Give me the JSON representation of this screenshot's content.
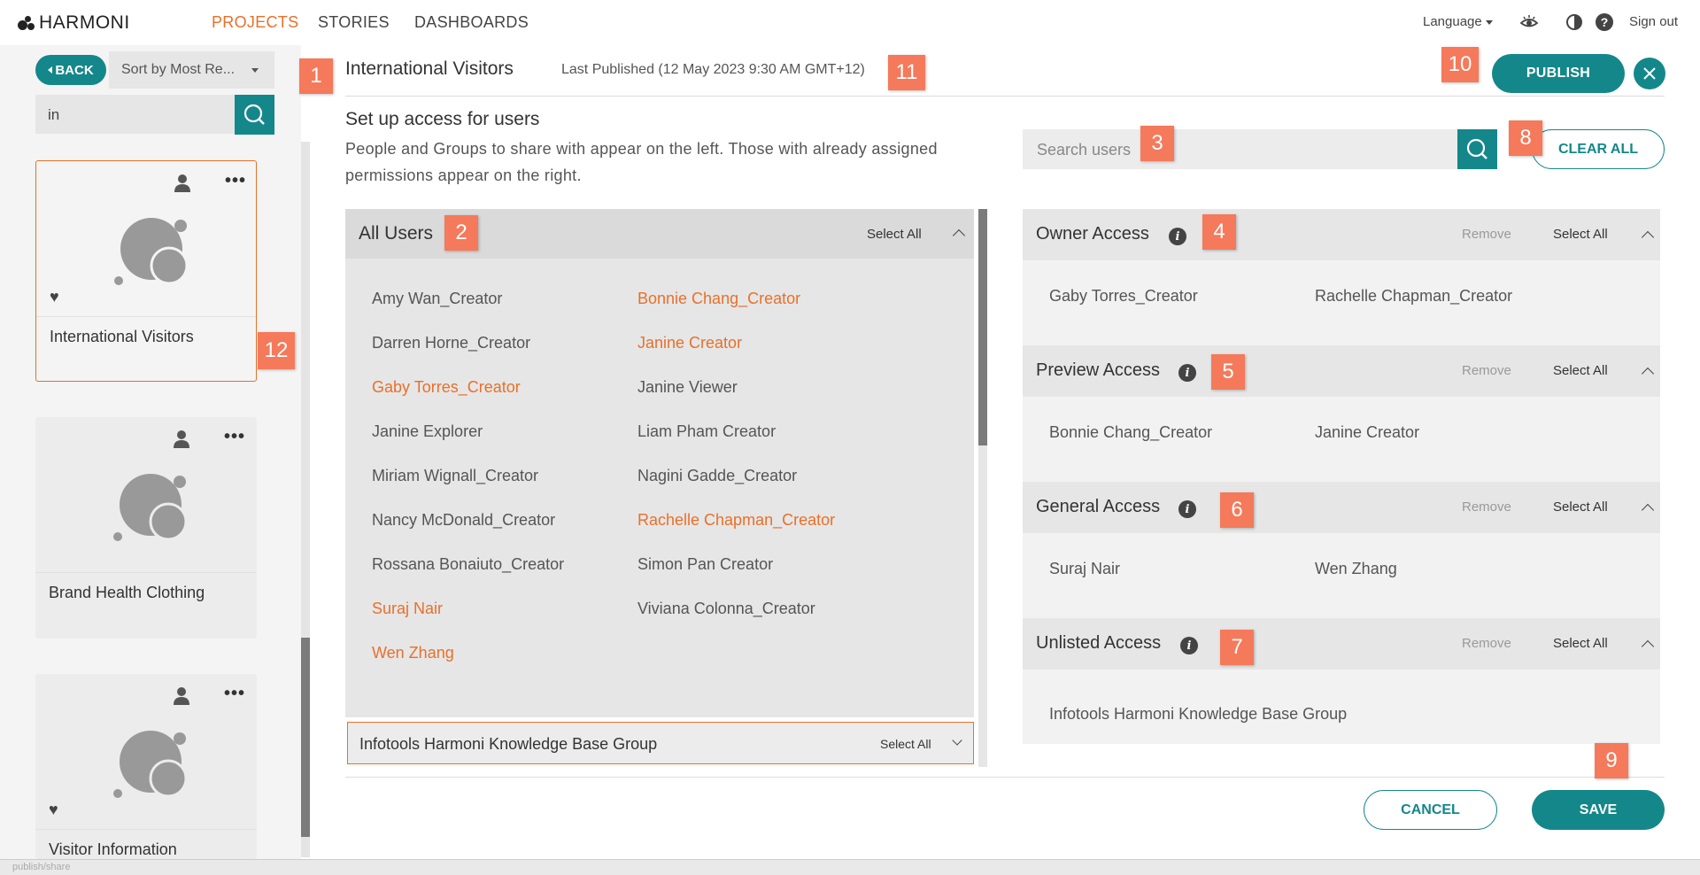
{
  "app": {
    "logo_text": "HARMONI",
    "nav": [
      "PROJECTS",
      "STORIES",
      "DASHBOARDS"
    ],
    "language_label": "Language",
    "signout_label": "Sign out"
  },
  "sidebar": {
    "back_label": "BACK",
    "sort_label": "Sort by Most Re...",
    "search_value": "in",
    "cards": [
      {
        "title": "International Visitors",
        "favorite": true,
        "selected": true
      },
      {
        "title": "Brand Health Clothing",
        "favorite": false,
        "selected": false
      },
      {
        "title": "Visitor Information",
        "favorite": true,
        "selected": false
      }
    ]
  },
  "header": {
    "title": "International Visitors",
    "last_published": "Last Published (12 May 2023 9:30 AM GMT+12)",
    "publish_label": "PUBLISH"
  },
  "setup": {
    "title": "Set up access for users",
    "description": "People and Groups to share with appear on the left. Those with already assigned permissions appear on the right.",
    "search_placeholder": "Search users",
    "clear_all_label": "CLEAR ALL"
  },
  "all_users": {
    "title": "All Users",
    "select_all_label": "Select All",
    "col1": [
      {
        "name": "Amy Wan_Creator",
        "assigned": false
      },
      {
        "name": "Darren Horne_Creator",
        "assigned": false
      },
      {
        "name": "Gaby Torres_Creator",
        "assigned": true
      },
      {
        "name": "Janine Explorer",
        "assigned": false
      },
      {
        "name": "Miriam Wignall_Creator",
        "assigned": false
      },
      {
        "name": "Nancy McDonald_Creator",
        "assigned": false
      },
      {
        "name": "Rossana Bonaiuto_Creator",
        "assigned": false
      },
      {
        "name": "Suraj Nair",
        "assigned": true
      },
      {
        "name": "Wen Zhang",
        "assigned": true
      }
    ],
    "col2": [
      {
        "name": "Bonnie Chang_Creator",
        "assigned": true
      },
      {
        "name": "Janine Creator",
        "assigned": true
      },
      {
        "name": "Janine Viewer",
        "assigned": false
      },
      {
        "name": "Liam Pham Creator",
        "assigned": false
      },
      {
        "name": "Nagini Gadde_Creator",
        "assigned": false
      },
      {
        "name": "Rachelle Chapman_Creator",
        "assigned": true
      },
      {
        "name": "Simon Pan Creator",
        "assigned": false
      },
      {
        "name": "Viviana Colonna_Creator",
        "assigned": false
      }
    ],
    "group_label": "Infotools Harmoni Knowledge Base Group",
    "group_select_all": "Select All"
  },
  "access": [
    {
      "title": "Owner Access",
      "users": [
        "Gaby Torres_Creator",
        "Rachelle Chapman_Creator"
      ]
    },
    {
      "title": "Preview Access",
      "users": [
        "Bonnie Chang_Creator",
        "Janine Creator"
      ]
    },
    {
      "title": "General Access",
      "users": [
        "Suraj Nair",
        "Wen Zhang"
      ]
    },
    {
      "title": "Unlisted Access",
      "users": [
        "Infotools Harmoni Knowledge Base Group"
      ]
    }
  ],
  "access_labels": {
    "remove": "Remove",
    "select_all": "Select All"
  },
  "footer": {
    "cancel_label": "CANCEL",
    "save_label": "SAVE",
    "status_text": "publish/share"
  },
  "badges": [
    "1",
    "2",
    "3",
    "4",
    "5",
    "6",
    "7",
    "8",
    "9",
    "10",
    "11",
    "12"
  ],
  "colors": {
    "teal": "#14878a",
    "orange": "#e8702a",
    "badge": "#f47a5b"
  }
}
